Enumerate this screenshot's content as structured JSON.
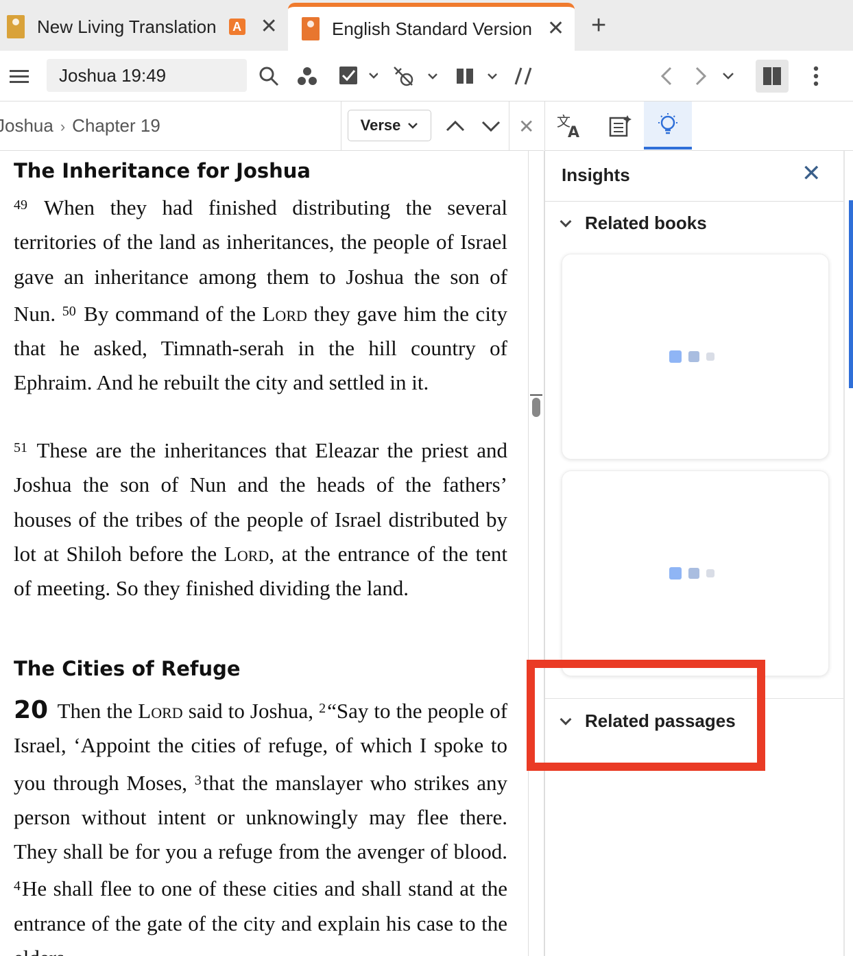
{
  "tabs": [
    {
      "label": "New Living Translation",
      "badge": "A"
    },
    {
      "label": "English Standard Version"
    }
  ],
  "toolbar": {
    "reference": "Joshua 19:49"
  },
  "breadcrumb": {
    "book": "Joshua",
    "chapter": "Chapter 19",
    "nav_mode": "Verse"
  },
  "text": {
    "heading1": "The Inheritance for Joshua",
    "v49_num": "49",
    "v49": "When they had finished distributing the several territories of the land as inheritances, the people of Israel gave an inheritance among them to Joshua the son of Nun.",
    "v50_num": "50",
    "v50a": "By command of the",
    "lord": "Lord",
    "v50b": "they gave him the city that he asked, Timnath-serah in the hill country of Ephraim. And he rebuilt the city and settled in it.",
    "v51_num": "51",
    "v51a": "These are the inheritances that Eleazar the priest and Joshua the son of Nun and the heads of the fathers’ houses of the tribes of the people of Israel distributed by lot at Shiloh before the",
    "v51b": ", at the entrance of the tent of meeting. So they finished dividing the land.",
    "heading2": "The Cities of Refuge",
    "chapter20": "20",
    "c20v1a": "Then the",
    "c20v1b": "said to Joshua,",
    "v2_num": "2",
    "v2": "“Say to the people of Israel, ‘Appoint the cities of refuge, of which I spoke to you through Moses,",
    "v3_num": "3",
    "v3": "that the manslayer who strikes any person without intent or unknowingly may flee there. They shall be for you a refuge from the avenger of blood.",
    "v4_num": "4",
    "v4": "He shall flee to one of these cities and shall stand at the entrance of the gate of the city and explain his case to the elders"
  },
  "insights": {
    "title": "Insights",
    "related_books": "Related books",
    "related_passages": "Related passages"
  },
  "colors": {
    "accent": "#2f6fd8",
    "tab_accent": "#f07b2e",
    "highlight": "#ea3b25"
  }
}
